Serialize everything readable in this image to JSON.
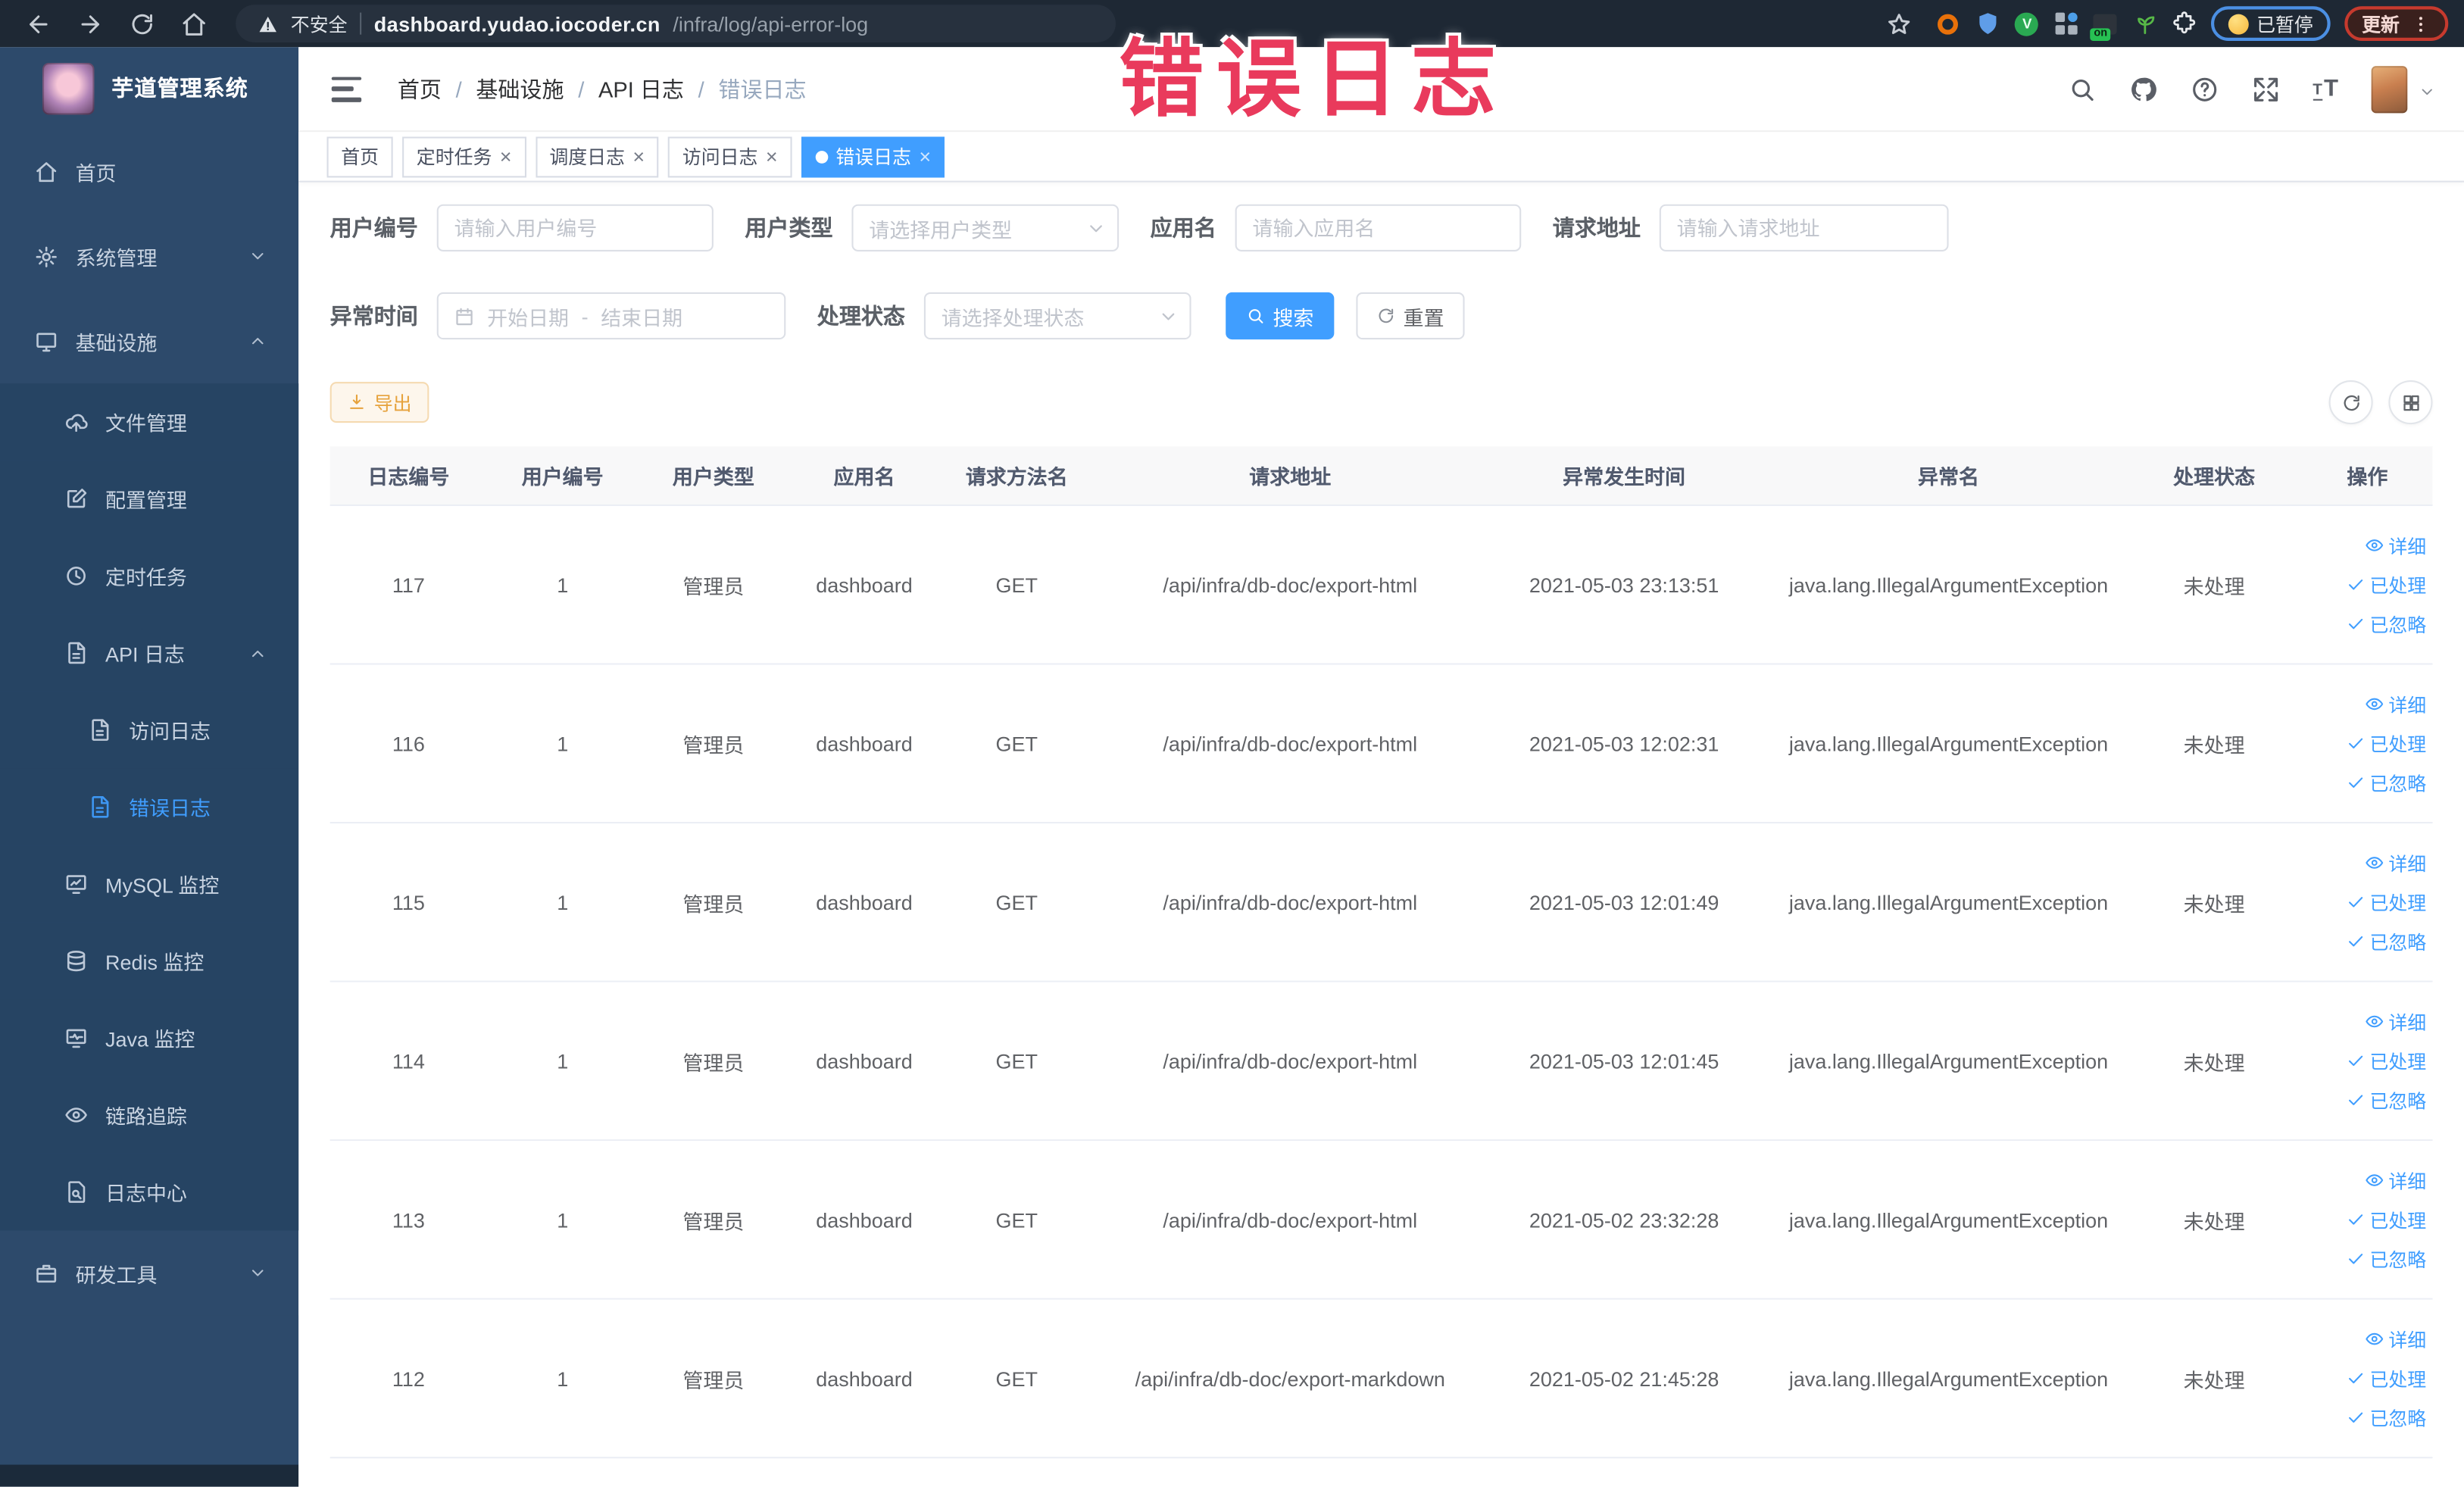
{
  "browser": {
    "security_label": "不安全",
    "url_host": "dashboard.yudao.iocoder.cn",
    "url_path": "/infra/log/api-error-log",
    "paused_badge": "已暂停",
    "update_label": "更新"
  },
  "overlay_title": {
    "text": "错误日志",
    "color": "#e93a5c"
  },
  "sidebar": {
    "app_title": "芋道管理系统",
    "items": [
      {
        "name": "home",
        "label": "首页",
        "icon": "home",
        "level": 0
      },
      {
        "name": "system-management",
        "label": "系统管理",
        "icon": "gear",
        "level": 0,
        "arrow": "down"
      },
      {
        "name": "infrastructure",
        "label": "基础设施",
        "icon": "monitor",
        "level": 0,
        "arrow": "up"
      },
      {
        "name": "file-management",
        "label": "文件管理",
        "icon": "cloud-upload",
        "level": 1
      },
      {
        "name": "config-management",
        "label": "配置管理",
        "icon": "edit",
        "level": 1
      },
      {
        "name": "scheduled-tasks",
        "label": "定时任务",
        "icon": "clock",
        "level": 1
      },
      {
        "name": "api-logs",
        "label": "API 日志",
        "icon": "file-text",
        "level": 1,
        "arrow": "up"
      },
      {
        "name": "access-log",
        "label": "访问日志",
        "icon": "file-text",
        "level": 2
      },
      {
        "name": "error-log",
        "label": "错误日志",
        "icon": "file-text",
        "level": 2,
        "active": true
      },
      {
        "name": "mysql-monitor",
        "label": "MySQL 监控",
        "icon": "chart",
        "level": 1
      },
      {
        "name": "redis-monitor",
        "label": "Redis 监控",
        "icon": "database",
        "level": 1
      },
      {
        "name": "java-monitor",
        "label": "Java 监控",
        "icon": "monitor-pulse",
        "level": 1
      },
      {
        "name": "trace",
        "label": "链路追踪",
        "icon": "eye",
        "level": 1
      },
      {
        "name": "log-center",
        "label": "日志中心",
        "icon": "file-search",
        "level": 1
      },
      {
        "name": "dev-tools",
        "label": "研发工具",
        "icon": "briefcase",
        "level": 0,
        "arrow": "down"
      }
    ]
  },
  "breadcrumb": [
    "首页",
    "基础设施",
    "API 日志",
    "错误日志"
  ],
  "tabs": [
    {
      "label": "首页",
      "closable": false,
      "active": false
    },
    {
      "label": "定时任务",
      "closable": true,
      "active": false
    },
    {
      "label": "调度日志",
      "closable": true,
      "active": false
    },
    {
      "label": "访问日志",
      "closable": true,
      "active": false
    },
    {
      "label": "错误日志",
      "closable": true,
      "active": true
    }
  ],
  "filters": {
    "user_id": {
      "label": "用户编号",
      "placeholder": "请输入用户编号"
    },
    "user_type": {
      "label": "用户类型",
      "placeholder": "请选择用户类型"
    },
    "app_name": {
      "label": "应用名",
      "placeholder": "请输入应用名"
    },
    "request_url": {
      "label": "请求地址",
      "placeholder": "请输入请求地址"
    },
    "exception_time": {
      "label": "异常时间",
      "start_placeholder": "开始日期",
      "separator": "-",
      "end_placeholder": "结束日期"
    },
    "process_status": {
      "label": "处理状态",
      "placeholder": "请选择处理状态"
    },
    "search_label": "搜索",
    "reset_label": "重置"
  },
  "toolbar": {
    "export_label": "导出"
  },
  "table": {
    "columns": [
      "日志编号",
      "用户编号",
      "用户类型",
      "应用名",
      "请求方法名",
      "请求地址",
      "异常发生时间",
      "异常名",
      "处理状态",
      "操作"
    ],
    "row_actions": [
      "详细",
      "已处理",
      "已忽略"
    ],
    "rows": [
      {
        "log_id": "117",
        "user_id": "1",
        "user_type": "管理员",
        "app_name": "dashboard",
        "method": "GET",
        "request_url": "/api/infra/db-doc/export-html",
        "error_time": "2021-05-03 23:13:51",
        "exception_name": "java.lang.IllegalArgumentException",
        "process_status": "未处理"
      },
      {
        "log_id": "116",
        "user_id": "1",
        "user_type": "管理员",
        "app_name": "dashboard",
        "method": "GET",
        "request_url": "/api/infra/db-doc/export-html",
        "error_time": "2021-05-03 12:02:31",
        "exception_name": "java.lang.IllegalArgumentException",
        "process_status": "未处理"
      },
      {
        "log_id": "115",
        "user_id": "1",
        "user_type": "管理员",
        "app_name": "dashboard",
        "method": "GET",
        "request_url": "/api/infra/db-doc/export-html",
        "error_time": "2021-05-03 12:01:49",
        "exception_name": "java.lang.IllegalArgumentException",
        "process_status": "未处理"
      },
      {
        "log_id": "114",
        "user_id": "1",
        "user_type": "管理员",
        "app_name": "dashboard",
        "method": "GET",
        "request_url": "/api/infra/db-doc/export-html",
        "error_time": "2021-05-03 12:01:45",
        "exception_name": "java.lang.IllegalArgumentException",
        "process_status": "未处理"
      },
      {
        "log_id": "113",
        "user_id": "1",
        "user_type": "管理员",
        "app_name": "dashboard",
        "method": "GET",
        "request_url": "/api/infra/db-doc/export-html",
        "error_time": "2021-05-02 23:32:28",
        "exception_name": "java.lang.IllegalArgumentException",
        "process_status": "未处理"
      },
      {
        "log_id": "112",
        "user_id": "1",
        "user_type": "管理员",
        "app_name": "dashboard",
        "method": "GET",
        "request_url": "/api/infra/db-doc/export-markdown",
        "error_time": "2021-05-02 21:45:28",
        "exception_name": "java.lang.IllegalArgumentException",
        "process_status": "未处理"
      }
    ]
  },
  "colors": {
    "accent": "#409eff",
    "sidebar_bg": "#2d4a6b",
    "submenu_bg": "#264463",
    "browser_bar_bg": "#1e2834",
    "overlay_text": "#e93a5c",
    "export_text": "#e6a23c",
    "table_header_bg": "#f8f8f9"
  }
}
